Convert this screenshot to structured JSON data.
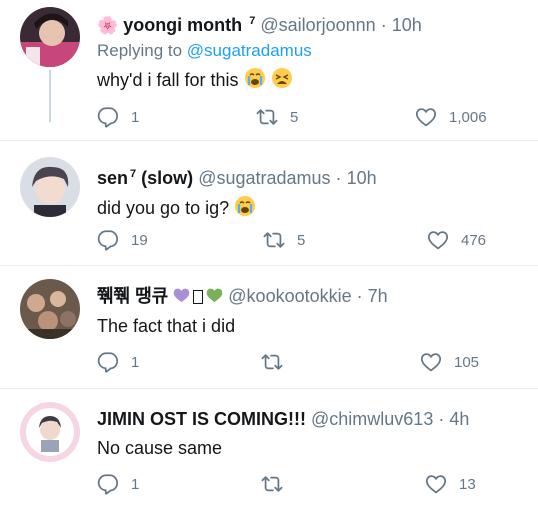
{
  "tweets": [
    {
      "flower_emoji": "🌸",
      "name": "yoongi month",
      "sup": "7",
      "handle": "@sailorjoonnn",
      "dot": "·",
      "time": "10h",
      "replying_prefix": "Replying to",
      "replying_handle": "@sugatradamus",
      "text": "why'd i fall for this",
      "replies": "1",
      "retweets": "5",
      "likes": "1,006"
    },
    {
      "name": "sen",
      "sup": "7",
      "name_suffix": "(slow)",
      "handle": "@sugatradamus",
      "dot": "·",
      "time": "10h",
      "text": "did you go to ig?",
      "replies": "19",
      "retweets": "5",
      "likes": "476"
    },
    {
      "name": "쮂쮂 땡큐",
      "handle": "@kookootokkie",
      "dot": "·",
      "time": "7h",
      "text": "The fact that i did",
      "replies": "1",
      "retweets": "",
      "likes": "105"
    },
    {
      "name": "JIMIN OST IS COMING!!!",
      "handle": "@chimwluv613",
      "dot": "·",
      "time": "4h",
      "text": "No cause same",
      "replies": "1",
      "retweets": "",
      "likes": "13"
    }
  ],
  "colors": {
    "text": "#14171a",
    "muted": "#657786",
    "link": "#1da1f2",
    "divider": "#e6ecf0",
    "thread": "#ccd6dd"
  }
}
